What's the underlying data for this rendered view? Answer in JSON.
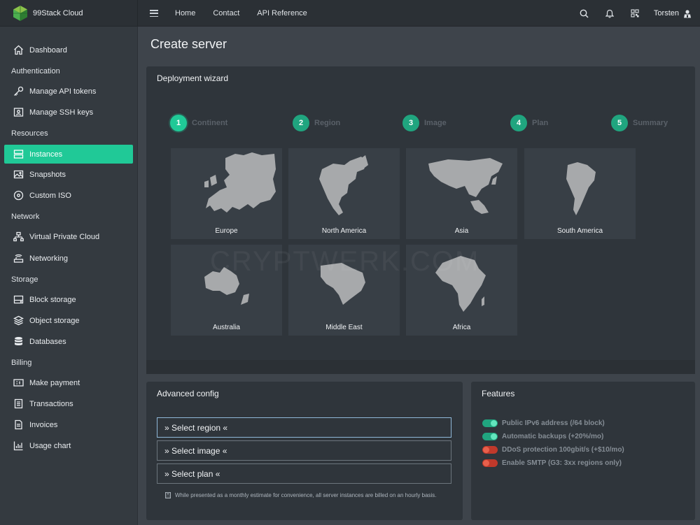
{
  "brand": {
    "name": "99Stack Cloud",
    "logo_icon": "green-cube-logo"
  },
  "topnav": {
    "links": [
      "Home",
      "Contact",
      "API Reference"
    ],
    "user": "Torsten"
  },
  "sidebar": {
    "dashboard": "Dashboard",
    "sections": {
      "authentication": "Authentication",
      "resources": "Resources",
      "network": "Network",
      "storage": "Storage",
      "billing": "Billing"
    },
    "items": {
      "api_tokens": "Manage API tokens",
      "ssh_keys": "Manage SSH keys",
      "instances": "Instances",
      "snapshots": "Snapshots",
      "custom_iso": "Custom ISO",
      "vpc": "Virtual Private Cloud",
      "networking": "Networking",
      "block_storage": "Block storage",
      "object_storage": "Object storage",
      "databases": "Databases",
      "make_payment": "Make payment",
      "transactions": "Transactions",
      "invoices": "Invoices",
      "usage_chart": "Usage chart"
    },
    "active": "Instances"
  },
  "page": {
    "title": "Create server"
  },
  "wizard": {
    "title": "Deployment wizard",
    "steps": [
      {
        "num": "1",
        "label": "Continent"
      },
      {
        "num": "2",
        "label": "Region"
      },
      {
        "num": "3",
        "label": "Image"
      },
      {
        "num": "4",
        "label": "Plan"
      },
      {
        "num": "5",
        "label": "Summary"
      }
    ],
    "continents": [
      "Europe",
      "North America",
      "Asia",
      "South America",
      "Australia",
      "Middle East",
      "Africa"
    ]
  },
  "watermark": "CRYPTWERK.COM",
  "advanced": {
    "title": "Advanced config",
    "select_region": "» Select region «",
    "select_image": "» Select image «",
    "select_plan": "» Select plan «",
    "note": "While presented as a monthly estimate for convenience, all server instances are billed on an hourly basis."
  },
  "features": {
    "title": "Features",
    "items": [
      {
        "label": "Public IPv6 address (/64 block)",
        "enabled": true
      },
      {
        "label": "Automatic backups (+20%/mo)",
        "enabled": true
      },
      {
        "label": "DDoS protection 100gbit/s (+$10/mo)",
        "enabled": false
      },
      {
        "label": "Enable SMTP (G3: 3xx regions only)",
        "enabled": false
      }
    ]
  },
  "colors": {
    "accent": "#20c997",
    "toggle_on": "#20a57f",
    "toggle_off": "#c0392b"
  }
}
